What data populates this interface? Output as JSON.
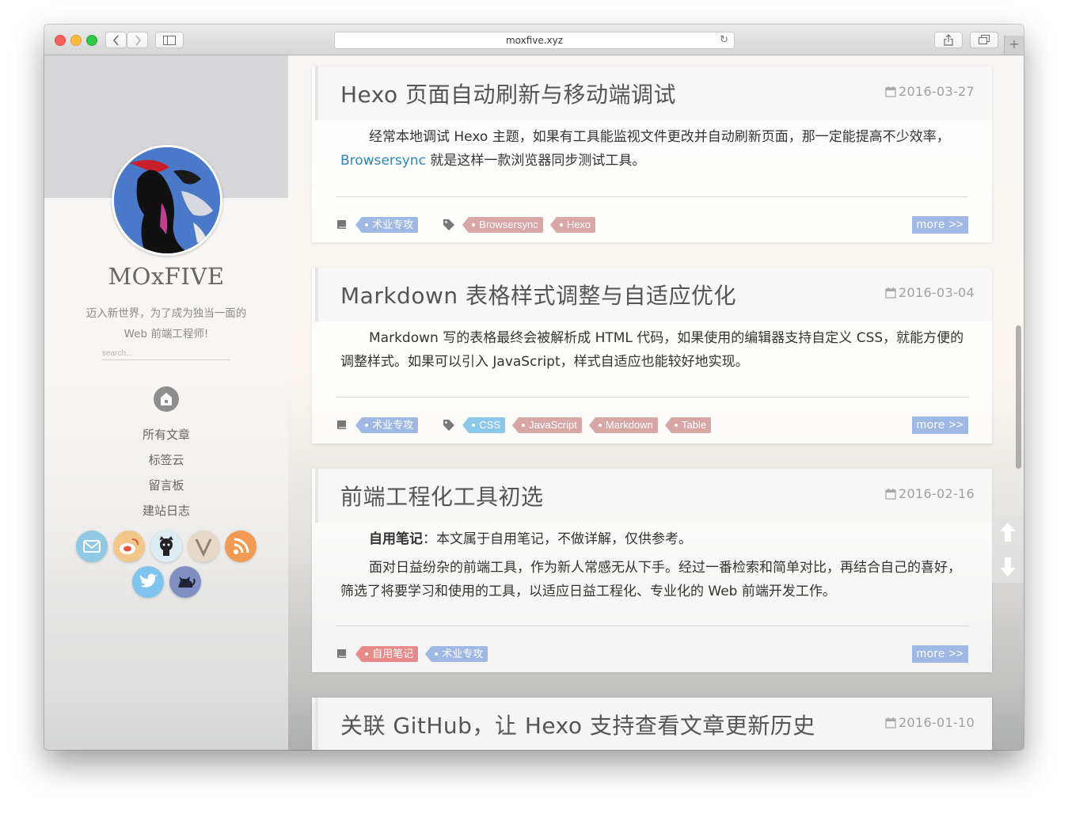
{
  "browser": {
    "url": "moxfive.xyz",
    "new_tab": "+",
    "colors": {
      "close": "#fc605c",
      "minimize": "#fdbc40",
      "zoom": "#34c84a"
    }
  },
  "sidebar": {
    "site_title": "MOxFIVE",
    "description_line1": "迈入新世界，为了成为独当一面的",
    "description_line2": "Web 前端工程师!",
    "search_placeholder": "search...",
    "nav": [
      "所有文章",
      "标签云",
      "留言板",
      "建站日志"
    ],
    "social_icons": [
      "mail-icon",
      "weibo-icon",
      "github-icon",
      "v-icon",
      "rss-icon",
      "twitter-icon",
      "cat-icon"
    ],
    "accent": "#9fb8e4"
  },
  "posts": [
    {
      "title": "Hexo 页面自动刷新与移动端调试",
      "date": "2016-03-27",
      "body_before_link": "经常本地调试 Hexo 主题，如果有工具能监视文件更改并自动刷新页面，那一定能提高不少效率，",
      "link_text": "Browsersync",
      "body_after_link": " 就是这样一款浏览器同步测试工具。",
      "categories": [
        "术业专攻"
      ],
      "tags": [
        "Browsersync",
        "Hexo"
      ],
      "more": "more >>"
    },
    {
      "title": "Markdown 表格样式调整与自适应优化",
      "date": "2016-03-04",
      "body": "Markdown 写的表格最终会被解析成 HTML 代码，如果使用的编辑器支持自定义 CSS，就能方便的调整样式。如果可以引入 JavaScript，样式自适应也能较好地实现。",
      "categories": [
        "术业专攻"
      ],
      "tags": [
        "CSS",
        "JavaScript",
        "Markdown",
        "Table"
      ],
      "more": "more >>"
    },
    {
      "title": "前端工程化工具初选",
      "date": "2016-02-16",
      "body_bold": "自用笔记",
      "body_line1": "：本文属于自用笔记，不做详解，仅供参考。",
      "body_para2": "面对日益纷杂的前端工具，作为新人常感无从下手。经过一番检索和简单对比，再结合自己的喜好，筛选了将要学习和使用的工具，以适应日益工程化、专业化的 Web 前端开发工作。",
      "categories": [
        "自用笔记",
        "术业专攻"
      ],
      "more": "more >>"
    },
    {
      "title": "关联 GitHub，让 Hexo 支持查看文章更新历史",
      "date": "2016-01-10"
    }
  ]
}
